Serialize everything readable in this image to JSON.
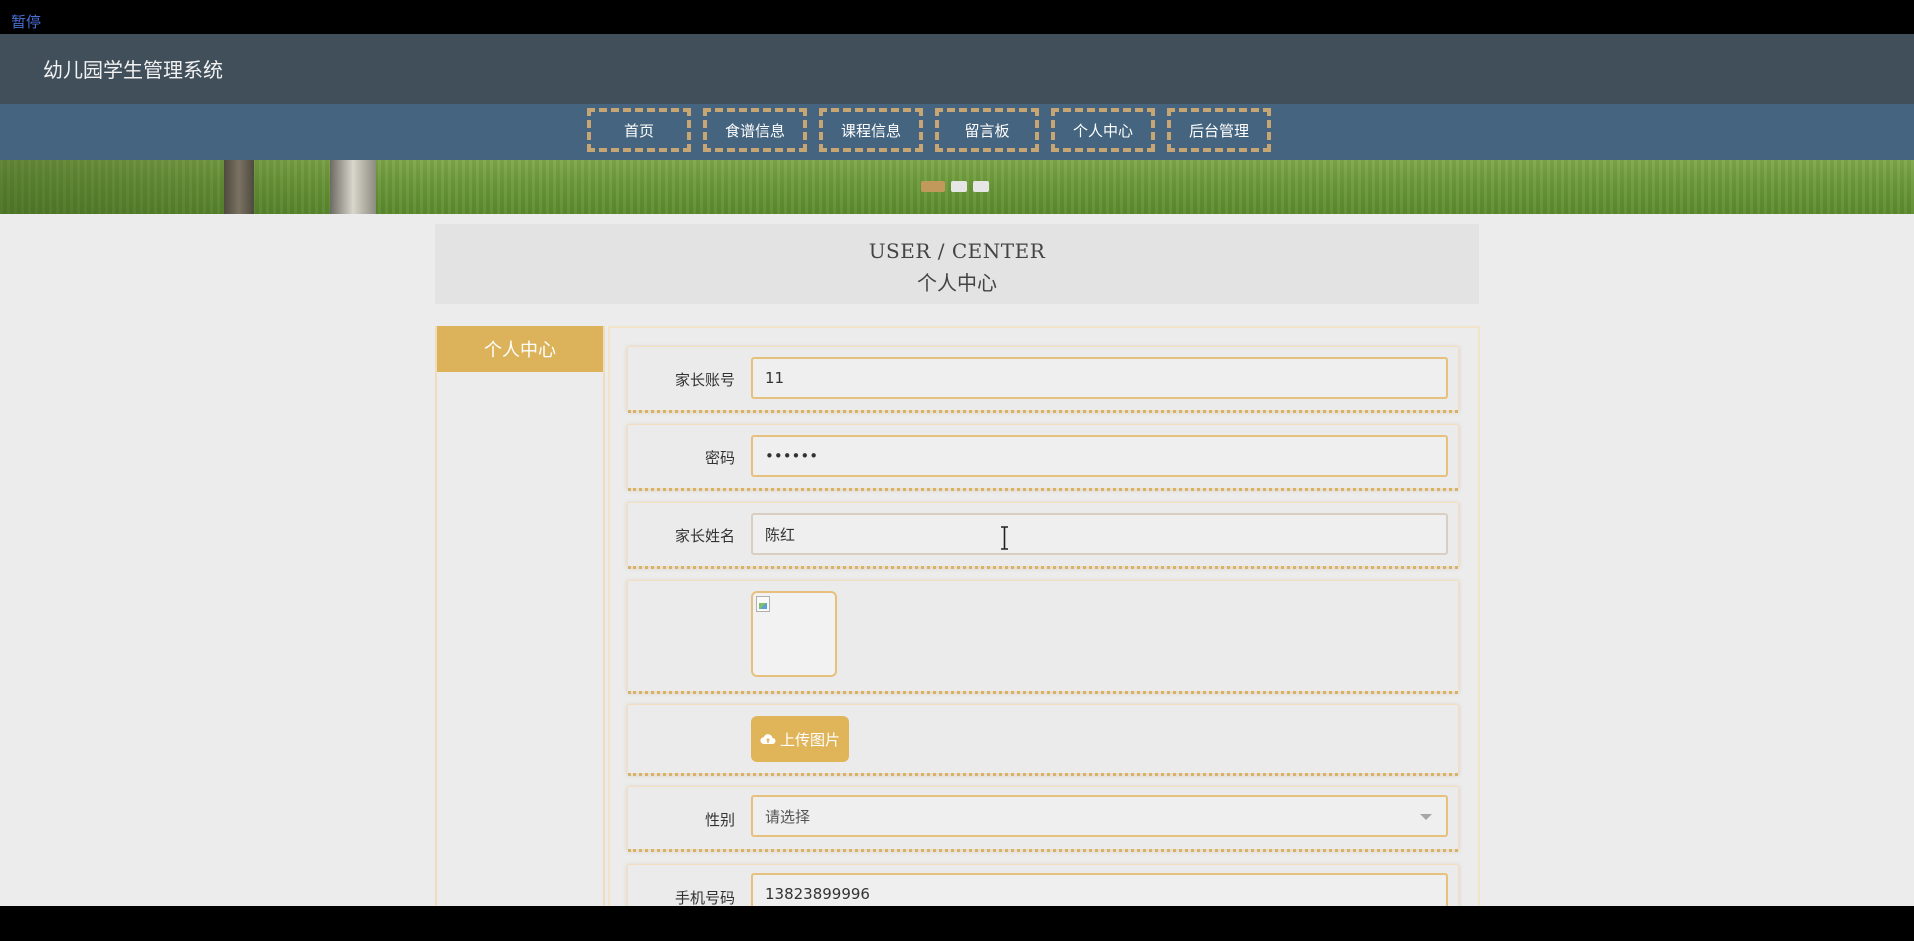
{
  "overlay": {
    "pause_label": "暂停"
  },
  "header": {
    "site_title": "幼儿园学生管理系统"
  },
  "nav": {
    "items": [
      {
        "label": "首页"
      },
      {
        "label": "食谱信息"
      },
      {
        "label": "课程信息"
      },
      {
        "label": "留言板"
      },
      {
        "label": "个人中心"
      },
      {
        "label": "后台管理"
      }
    ]
  },
  "carousel": {
    "active_index": 0,
    "dot_count": 3
  },
  "page_heading": {
    "en": "USER / CENTER",
    "cn": "个人中心"
  },
  "sidebar": {
    "tab_label": "个人中心"
  },
  "form": {
    "account": {
      "label": "家长账号",
      "value": "11"
    },
    "password": {
      "label": "密码",
      "value": "••••••"
    },
    "name": {
      "label": "家长姓名",
      "value": "陈红"
    },
    "avatar": {
      "upload_label": "上传图片"
    },
    "gender": {
      "label": "性别",
      "placeholder": "请选择"
    },
    "phone": {
      "label": "手机号码",
      "value": "13823899996"
    }
  },
  "colors": {
    "header_bg": "#414f5b",
    "nav_bg": "#44647f",
    "accent": "#dcb35a",
    "nav_border": "#c7a673"
  },
  "icons": [
    "cloud-upload-icon",
    "chevron-down-icon",
    "broken-image-icon",
    "text-cursor-icon"
  ]
}
